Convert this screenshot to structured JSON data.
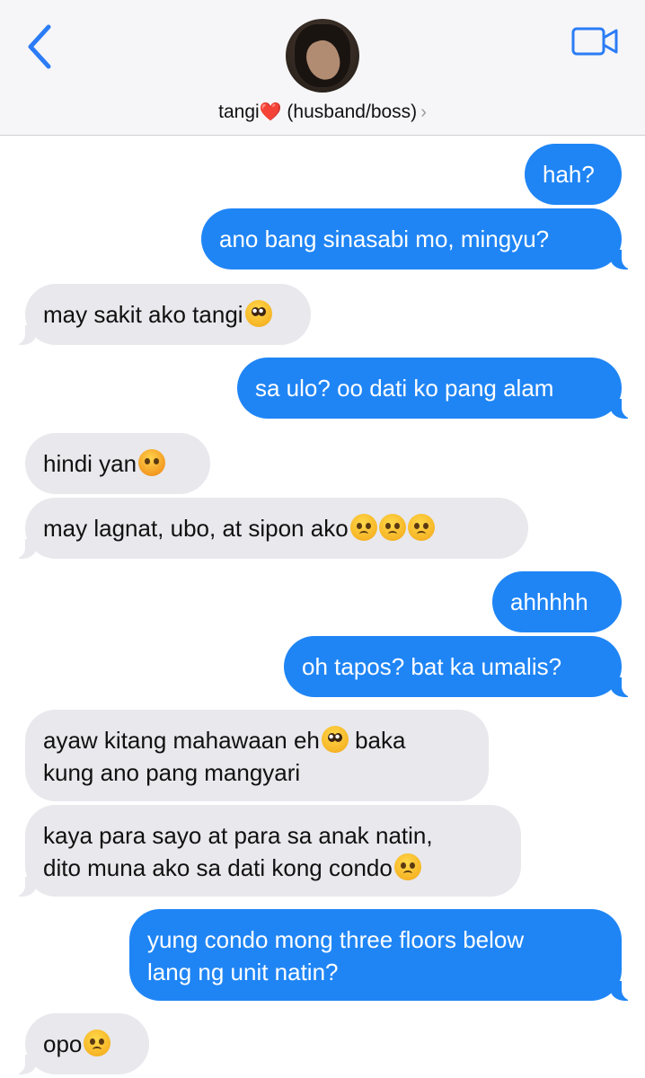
{
  "header": {
    "contact_name": "tangi",
    "contact_heart": "❤️",
    "contact_suffix": "(husband/boss)",
    "chevron": "›",
    "back_icon": "chevron-left-icon",
    "video_icon": "video-camera-icon"
  },
  "colors": {
    "outgoing": "#1f85f5",
    "incoming": "#e8e8ed",
    "accent": "#2b7cf5"
  },
  "messages": [
    {
      "side": "out",
      "text": "hah?"
    },
    {
      "side": "out",
      "text": "ano bang sinasabi mo, mingyu?"
    },
    {
      "side": "in",
      "text": "may sakit ako tangi",
      "emoji": [
        "pleading-face"
      ]
    },
    {
      "side": "out",
      "text": "sa ulo? oo dati ko pang alam"
    },
    {
      "side": "in",
      "text": "hindi yan",
      "emoji": [
        "angry-face"
      ]
    },
    {
      "side": "in",
      "text": "may lagnat, ubo, at sipon ako",
      "emoji": [
        "disappointed-face",
        "disappointed-face",
        "disappointed-face"
      ]
    },
    {
      "side": "out",
      "text": "ahhhhh"
    },
    {
      "side": "out",
      "text": "oh tapos? bat ka umalis?"
    },
    {
      "side": "in",
      "line1_a": "ayaw kitang mahawaan eh",
      "line1_b": " baka",
      "line2": "kung ano pang mangyari",
      "emoji": [
        "pleading-face"
      ]
    },
    {
      "side": "in",
      "line1": "kaya para sayo at para sa anak natin,",
      "line2": "dito muna ako sa dati kong condo",
      "emoji": [
        "disappointed-face"
      ]
    },
    {
      "side": "out",
      "line1": "yung condo mong three floors below",
      "line2": "lang ng unit natin?"
    },
    {
      "side": "in",
      "text": "opo",
      "emoji": [
        "disappointed-face"
      ]
    }
  ]
}
